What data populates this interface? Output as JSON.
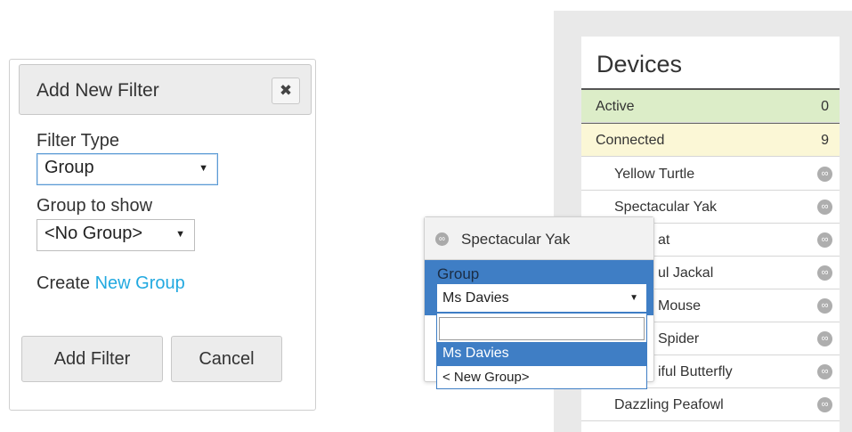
{
  "filter_panel": {
    "title": "Add New Filter",
    "close_icon": "close-icon",
    "filter_type_label": "Filter Type",
    "filter_type_value": "Group",
    "group_label": "Group to show",
    "group_value": "<No Group>",
    "create_text": "Create",
    "create_link": "New Group",
    "add_button": "Add Filter",
    "cancel_button": "Cancel"
  },
  "devices": {
    "title": "Devices",
    "active_label": "Active",
    "active_count": "0",
    "connected_label": "Connected",
    "connected_count": "9",
    "items": [
      "Yellow Turtle",
      "Spectacular Yak",
      "at",
      "ul Jackal",
      "Mouse",
      "Spider",
      "iful Butterfly",
      "Dazzling Peafowl"
    ],
    "item_icon": "device-status-icon"
  },
  "popover": {
    "title": "Spectacular Yak",
    "icon": "device-status-icon",
    "group_label": "Group",
    "selected_value": "Ms Davies",
    "search_value": "",
    "options": [
      "Ms Davies",
      "< New Group>"
    ]
  },
  "colors": {
    "accent_blue": "#3f7ec5",
    "link_blue": "#22a9e0",
    "active_green": "#dcedc8",
    "connected_yellow": "#fbf7d6"
  }
}
